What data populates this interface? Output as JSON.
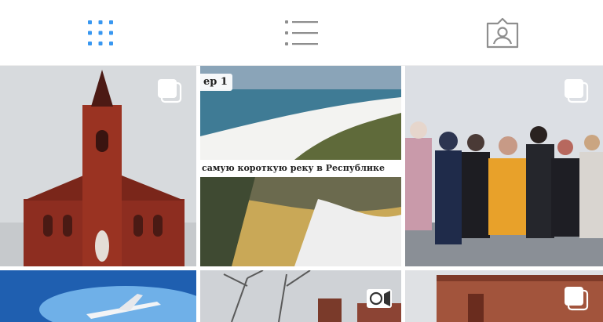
{
  "tabs": [
    {
      "id": "grid",
      "icon": "grid-icon",
      "active": true
    },
    {
      "id": "list",
      "icon": "list-icon",
      "active": false
    },
    {
      "id": "tagged",
      "icon": "tagged-user-icon",
      "active": false
    }
  ],
  "colors": {
    "accent": "#3897f0",
    "icon_inactive": "#8e8e8e",
    "badge": "#ffffff"
  },
  "posts": [
    {
      "subject": "red brick church with bell tower",
      "badge": "carousel-icon"
    },
    {
      "subject": "beach and forest collage",
      "badge": "none",
      "banner_top": "ер 1",
      "banner_middle": "самую короткую реку в Республике"
    },
    {
      "subject": "group photo in winter",
      "badge": "carousel-icon"
    },
    {
      "subject": "airplane on blue background",
      "badge": "none"
    },
    {
      "subject": "bare trees and roofs",
      "badge": "video-icon"
    },
    {
      "subject": "brick building ruins",
      "badge": "carousel-icon"
    }
  ]
}
